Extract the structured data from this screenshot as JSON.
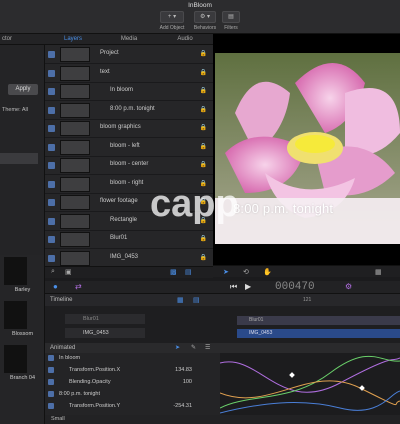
{
  "app": {
    "title": "InBloom"
  },
  "toolbar": {
    "add_object": "Add Object",
    "behaviors": "Behaviors",
    "filters": "Filters"
  },
  "tabs": [
    "Layers",
    "Media",
    "Audio"
  ],
  "inspector": {
    "title_partial": "ctor",
    "apply_label": "Apply",
    "theme_label": "Theme: All"
  },
  "layers": [
    {
      "name": "Project",
      "indent": 0
    },
    {
      "name": "text",
      "indent": 0
    },
    {
      "name": "In bloom",
      "indent": 1
    },
    {
      "name": "8:00 p.m. tonight",
      "indent": 1
    },
    {
      "name": "bloom graphics",
      "indent": 0
    },
    {
      "name": "bloom - left",
      "indent": 1
    },
    {
      "name": "bloom - center",
      "indent": 1
    },
    {
      "name": "bloom - right",
      "indent": 1
    },
    {
      "name": "flower footage",
      "indent": 0
    },
    {
      "name": "Rectangle",
      "indent": 1
    },
    {
      "name": "Blur01",
      "indent": 1
    },
    {
      "name": "IMG_0453",
      "indent": 1
    }
  ],
  "canvas": {
    "overlay_text": "8:00 p.m. tonight",
    "watermark": "capp"
  },
  "library": [
    {
      "label": "Barley"
    },
    {
      "label": "Blossom"
    },
    {
      "label": "Branch 04"
    }
  ],
  "transport": {
    "timecode": "000470"
  },
  "timeline": {
    "label": "Timeline",
    "rows": [
      {
        "name": "Blur01"
      },
      {
        "name": "IMG_0453"
      }
    ],
    "ruler_mark": "121"
  },
  "animated": {
    "header": "Animated",
    "rows": [
      {
        "label": "In bloom",
        "value": ""
      },
      {
        "label": "Transform.Position.X",
        "value": "134.83"
      },
      {
        "label": "Blending.Opacity",
        "value": "100"
      },
      {
        "label": "8:00 p.m. tonight",
        "value": ""
      },
      {
        "label": "Transform.Position.Y",
        "value": "-254.31"
      }
    ]
  },
  "footer": {
    "size_select": "Small"
  },
  "colors": {
    "accent": "#4a8fe8",
    "curve_purple": "#b06ee0",
    "curve_green": "#6ad06a",
    "curve_orange": "#e0a050",
    "curve_blue": "#4a7fd8"
  }
}
